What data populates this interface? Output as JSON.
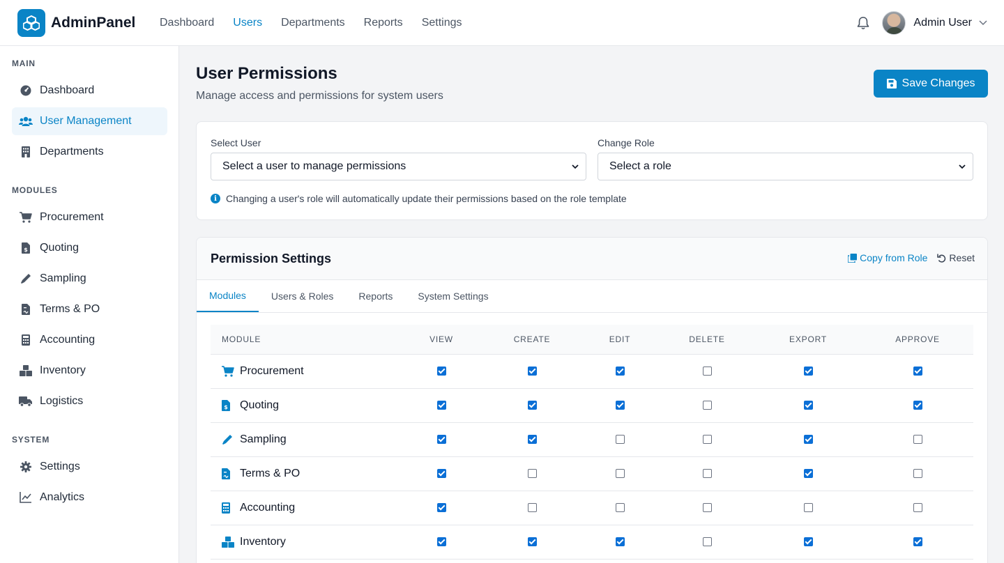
{
  "app": {
    "name": "AdminPanel"
  },
  "topnav": [
    {
      "label": "Dashboard",
      "active": false
    },
    {
      "label": "Users",
      "active": true
    },
    {
      "label": "Departments",
      "active": false
    },
    {
      "label": "Reports",
      "active": false
    },
    {
      "label": "Settings",
      "active": false
    }
  ],
  "user": {
    "name": "Admin User"
  },
  "sidebar": {
    "sections": [
      {
        "title": "MAIN",
        "items": [
          {
            "label": "Dashboard",
            "icon": "dashboard-icon",
            "active": false
          },
          {
            "label": "User Management",
            "icon": "users-icon",
            "active": true
          },
          {
            "label": "Departments",
            "icon": "building-icon",
            "active": false
          }
        ]
      },
      {
        "title": "MODULES",
        "items": [
          {
            "label": "Procurement",
            "icon": "cart-icon",
            "active": false
          },
          {
            "label": "Quoting",
            "icon": "invoice-icon",
            "active": false
          },
          {
            "label": "Sampling",
            "icon": "eyedropper-icon",
            "active": false
          },
          {
            "label": "Terms & PO",
            "icon": "contract-icon",
            "active": false
          },
          {
            "label": "Accounting",
            "icon": "calculator-icon",
            "active": false
          },
          {
            "label": "Inventory",
            "icon": "boxes-icon",
            "active": false
          },
          {
            "label": "Logistics",
            "icon": "truck-icon",
            "active": false
          }
        ]
      },
      {
        "title": "SYSTEM",
        "items": [
          {
            "label": "Settings",
            "icon": "gear-icon",
            "active": false
          },
          {
            "label": "Analytics",
            "icon": "chart-line-icon",
            "active": false
          }
        ]
      }
    ]
  },
  "page": {
    "title": "User Permissions",
    "subtitle": "Manage access and permissions for system users",
    "save_label": "Save Changes"
  },
  "selectors": {
    "user_label": "Select User",
    "user_value": "Select a user to manage permissions",
    "role_label": "Change Role",
    "role_value": "Select a role",
    "hint": "Changing a user's role will automatically update their permissions based on the role template"
  },
  "permissions": {
    "title": "Permission Settings",
    "copy_label": "Copy from Role",
    "reset_label": "Reset",
    "tabs": [
      {
        "label": "Modules",
        "active": true
      },
      {
        "label": "Users & Roles",
        "active": false
      },
      {
        "label": "Reports",
        "active": false
      },
      {
        "label": "System Settings",
        "active": false
      }
    ],
    "columns": [
      "MODULE",
      "VIEW",
      "CREATE",
      "EDIT",
      "DELETE",
      "EXPORT",
      "APPROVE"
    ],
    "rows": [
      {
        "module": "Procurement",
        "icon": "cart-icon",
        "perms": [
          true,
          true,
          true,
          false,
          true,
          true
        ]
      },
      {
        "module": "Quoting",
        "icon": "invoice-icon",
        "perms": [
          true,
          true,
          true,
          false,
          true,
          true
        ]
      },
      {
        "module": "Sampling",
        "icon": "eyedropper-icon",
        "perms": [
          true,
          true,
          false,
          false,
          true,
          false
        ]
      },
      {
        "module": "Terms & PO",
        "icon": "contract-icon",
        "perms": [
          true,
          false,
          false,
          false,
          true,
          false
        ]
      },
      {
        "module": "Accounting",
        "icon": "calculator-icon",
        "perms": [
          true,
          false,
          false,
          false,
          false,
          false
        ]
      },
      {
        "module": "Inventory",
        "icon": "boxes-icon",
        "perms": [
          true,
          true,
          true,
          false,
          true,
          true
        ]
      }
    ]
  },
  "colors": {
    "accent": "#0a84c6",
    "checkbox": "#0b6fd6"
  }
}
